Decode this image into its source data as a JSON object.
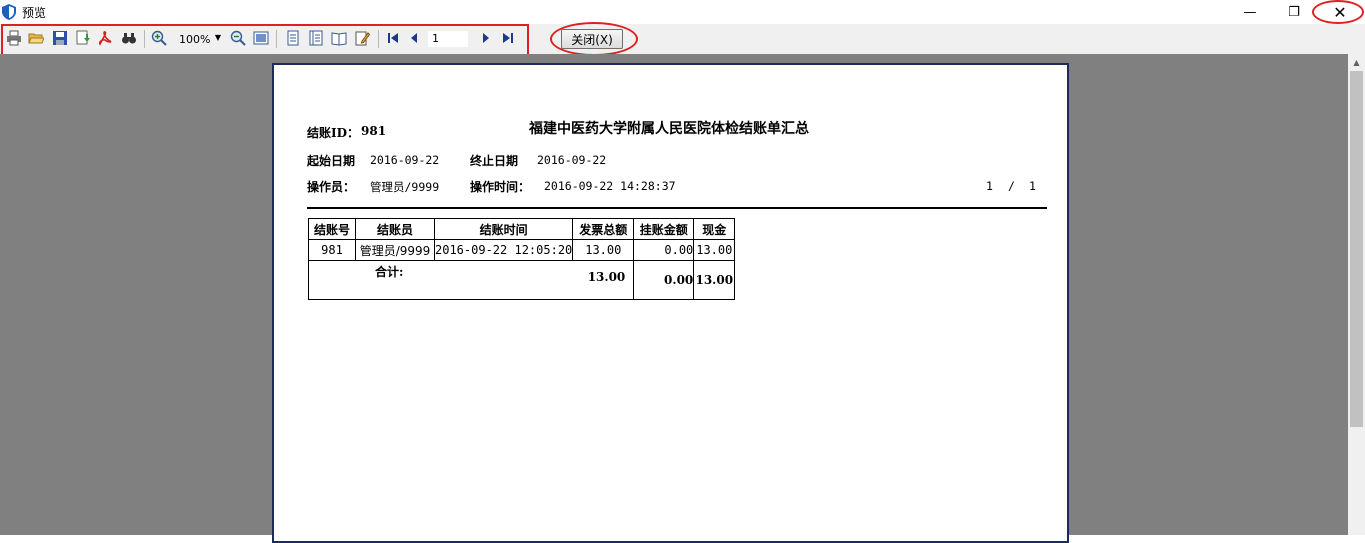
{
  "window": {
    "title": "预览",
    "minimize": "—",
    "restore": "❐",
    "close": "✕"
  },
  "toolbar": {
    "zoom_value": "100%",
    "page_value": "1",
    "close_label": "关闭(X)"
  },
  "report": {
    "title": "福建中医药大学附属人民医院体检结账单汇总",
    "settle_id_label": "结账ID：",
    "settle_id_value": "981",
    "start_date_label": "起始日期",
    "start_date_value": "2016-09-22",
    "end_date_label": "终止日期",
    "end_date_value": "2016-09-22",
    "operator_label": "操作员：",
    "operator_value": "管理员/9999",
    "op_time_label": "操作时间：",
    "op_time_value": "2016-09-22 14:28:37",
    "page_current": "1",
    "page_sep": "/",
    "page_total": "1",
    "table": {
      "headers": [
        "结账号",
        "结账员",
        "结账时间",
        "发票总额",
        "挂账金额",
        "现金"
      ],
      "rows": [
        [
          "981",
          "管理员/9999",
          "2016-09-22 12:05:20",
          "13.00",
          "0.00",
          "13.00"
        ]
      ],
      "total_label": "合计:",
      "total_invoice": "13.00",
      "total_credit": "0.00",
      "total_cash": "13.00"
    }
  }
}
